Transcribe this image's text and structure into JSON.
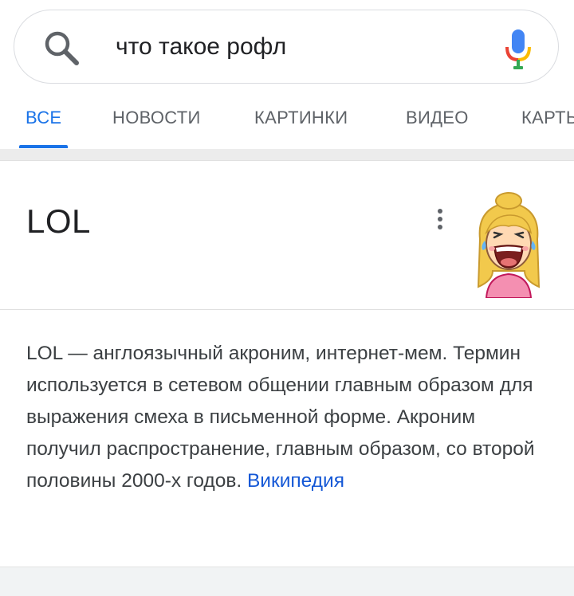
{
  "search": {
    "query": "что такое рофл"
  },
  "tabs": [
    {
      "label": "ВСЕ",
      "active": true
    },
    {
      "label": "НОВОСТИ",
      "active": false
    },
    {
      "label": "КАРТИНКИ",
      "active": false
    },
    {
      "label": "ВИДЕО",
      "active": false
    },
    {
      "label": "КАРТЫ",
      "active": false
    }
  ],
  "card": {
    "title": "LOL",
    "image_icon": "laughing-girl-emoji",
    "description": "LOL — англоязычный акроним, интернет-мем. Термин используется в сетевом общении главным образом для выражения смеха в письменной форме. Акроним получил распространение, главным образом, со второй половины 2000-х годов.",
    "source_link": "Википедия"
  },
  "colors": {
    "accent": "#1a73e8",
    "link": "#1558d6",
    "text": "#3c4043",
    "muted": "#5f6368"
  }
}
